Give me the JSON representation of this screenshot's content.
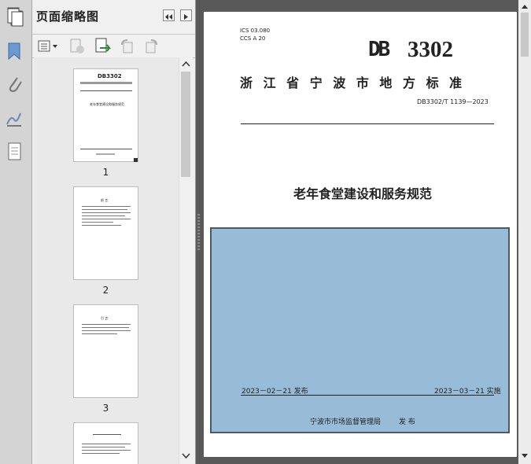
{
  "panel": {
    "title": "页面缩略图"
  },
  "thumbnails": [
    {
      "label": "1"
    },
    {
      "label": "2"
    },
    {
      "label": "3"
    }
  ],
  "document": {
    "ics_line": "ICS  03.080",
    "ccs_line": "CCS  A 20",
    "db_logo": "DB",
    "db_number": "3302",
    "standard_category": "浙 江 省 宁 波 市 地 方 标 准",
    "standard_id": "DB3302/T 1139—2023",
    "title": "老年食堂建设和服务规范",
    "publish_date": "2023－02－21 发布",
    "implement_date": "2023－03－21 实施",
    "issuer": "宁波市市场监督管理局",
    "issue_word": "发 布"
  },
  "thumb1": {
    "db_number": "DB3302",
    "title": "老年食堂建设和服务规范"
  },
  "thumb2": {
    "heading": "前 言"
  },
  "thumb3": {
    "heading": "引 言"
  },
  "colors": {
    "cover_box": "#98bcd8",
    "doc_background": "#595959"
  }
}
